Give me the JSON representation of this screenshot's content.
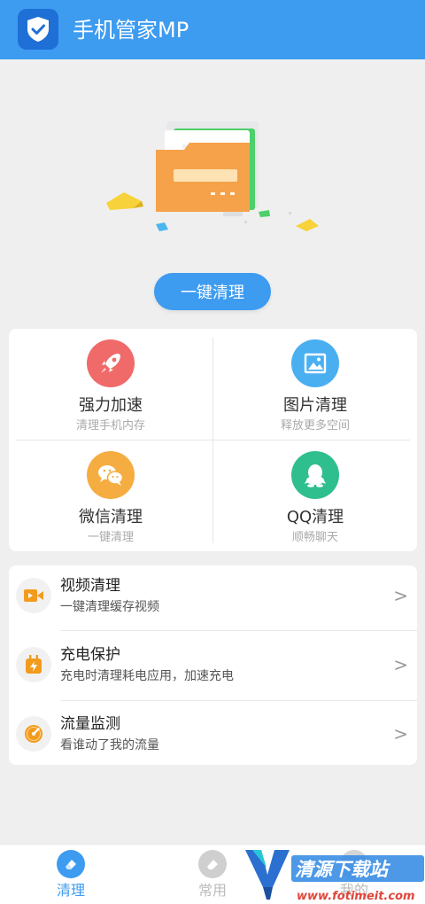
{
  "header": {
    "title": "手机管家MP",
    "background": "#3d9bf0"
  },
  "main": {
    "clean_button_label": "一键清理"
  },
  "grid": [
    {
      "title": "强力加速",
      "subtitle": "清理手机内存",
      "icon": "rocket-icon",
      "color": "#f06a6a"
    },
    {
      "title": "图片清理",
      "subtitle": "释放更多空间",
      "icon": "image-icon",
      "color": "#4aaff0"
    },
    {
      "title": "微信清理",
      "subtitle": "一键清理",
      "icon": "wechat-icon",
      "color": "#f5ad41"
    },
    {
      "title": "QQ清理",
      "subtitle": "顺畅聊天",
      "icon": "qq-icon",
      "color": "#2fbf8e"
    }
  ],
  "list": [
    {
      "title": "视频清理",
      "subtitle": "一键清理缓存视频",
      "icon": "video-icon"
    },
    {
      "title": "充电保护",
      "subtitle": "充电时清理耗电应用，加速充电",
      "icon": "battery-icon"
    },
    {
      "title": "流量监测",
      "subtitle": "看谁动了我的流量",
      "icon": "gauge-icon"
    }
  ],
  "chevron": ">",
  "tabs": [
    {
      "label": "清理",
      "icon": "eraser-icon",
      "active": true
    },
    {
      "label": "常用",
      "icon": "common-icon",
      "active": false
    },
    {
      "label": "我的",
      "icon": "profile-icon",
      "active": false
    }
  ],
  "watermark": {
    "name": "清源下载站",
    "url": "www.fotimeit.com"
  }
}
